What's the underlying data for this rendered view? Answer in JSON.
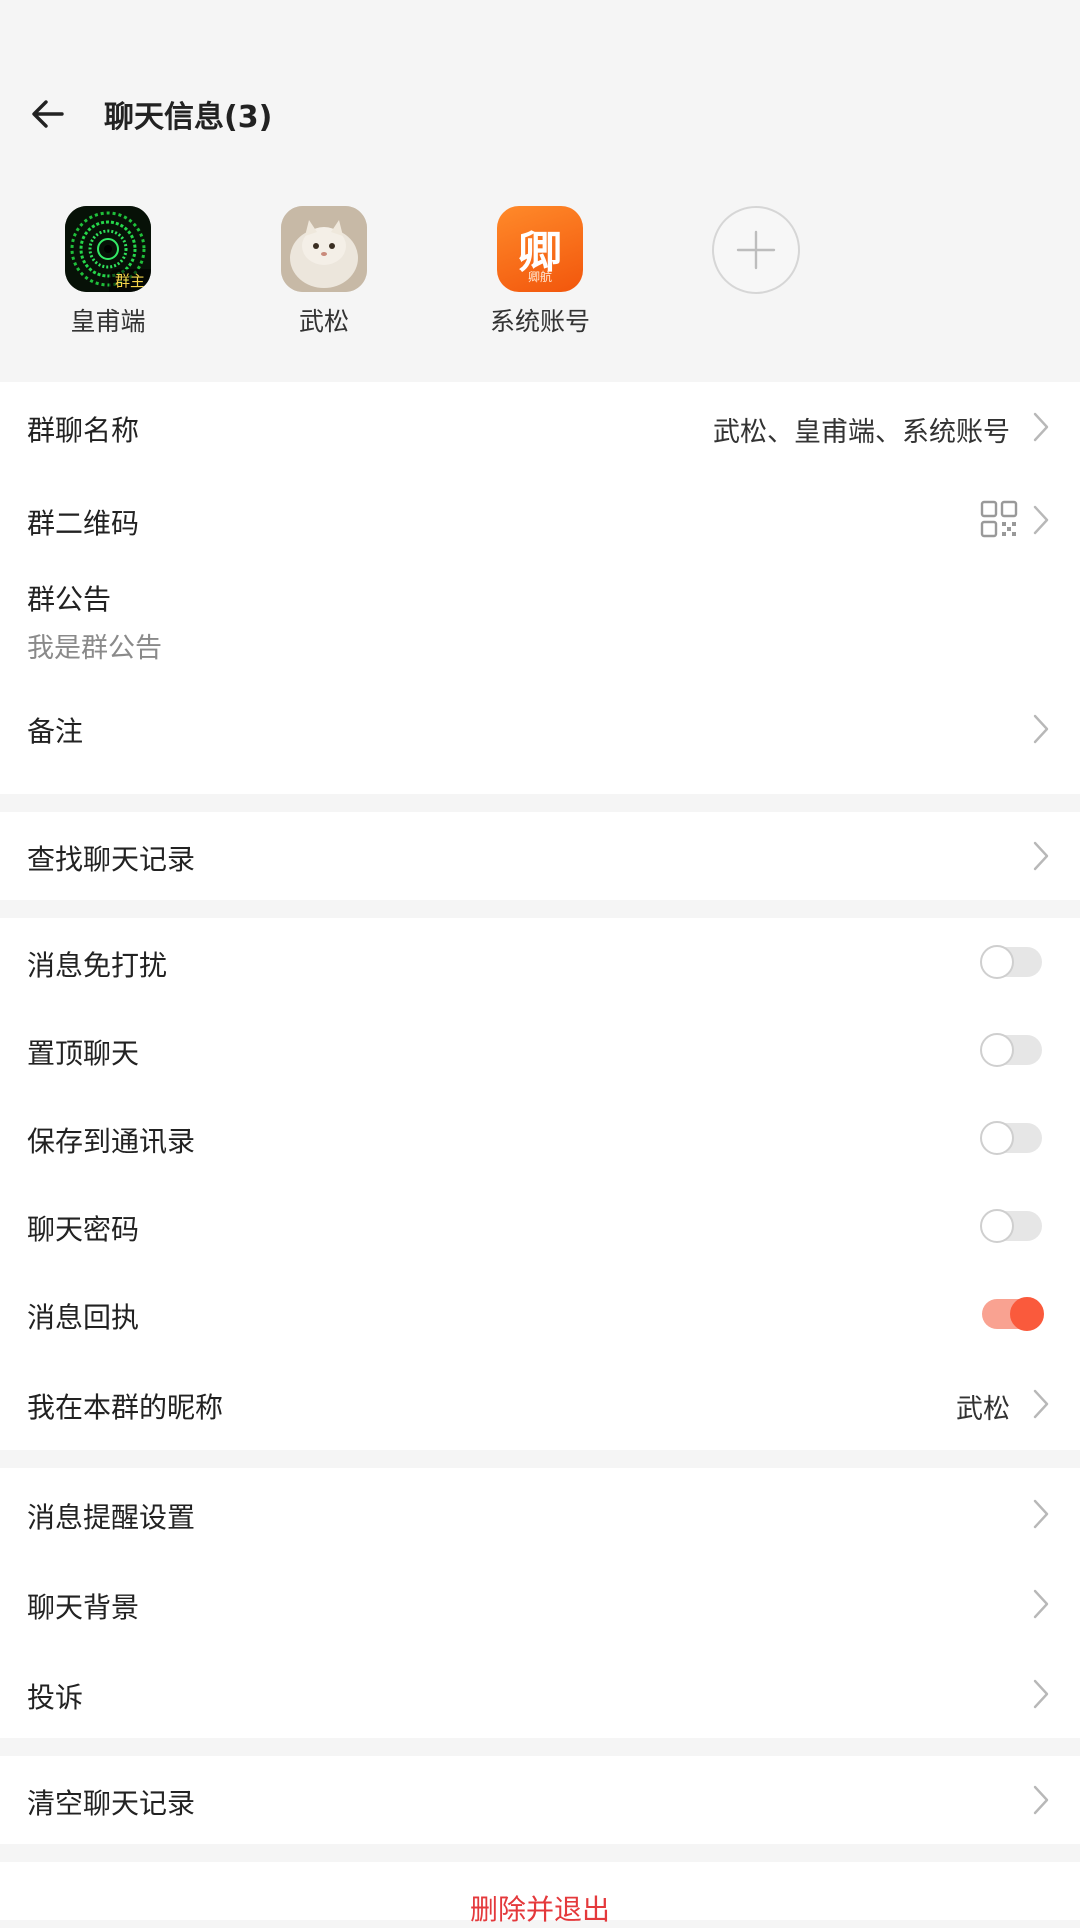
{
  "header": {
    "title": "聊天信息(3)"
  },
  "members": [
    {
      "name": "皇甫端",
      "badge": "群主",
      "avatar": "spiral-avatar"
    },
    {
      "name": "武松",
      "avatar": "cat-avatar"
    },
    {
      "name": "系统账号",
      "avatar": "app-logo-avatar",
      "logo_text": "卿",
      "logo_sub": "卿航"
    }
  ],
  "group": {
    "name_label": "群聊名称",
    "name_value": "武松、皇甫端、系统账号",
    "qrcode_label": "群二维码",
    "notice_label": "群公告",
    "notice_value": "我是群公告",
    "remark_label": "备注"
  },
  "search": {
    "label": "查找聊天记录"
  },
  "settings": {
    "mute_label": "消息免打扰",
    "mute_on": false,
    "pin_label": "置顶聊天",
    "pin_on": false,
    "save_contacts_label": "保存到通讯录",
    "save_contacts_on": false,
    "password_label": "聊天密码",
    "password_on": false,
    "receipt_label": "消息回执",
    "receipt_on": true,
    "nickname_label": "我在本群的昵称",
    "nickname_value": "武松"
  },
  "more": {
    "notify_label": "消息提醒设置",
    "background_label": "聊天背景",
    "complaint_label": "投诉"
  },
  "clear": {
    "label": "清空聊天记录"
  },
  "exit": {
    "label": "删除并退出"
  },
  "colors": {
    "accent": "#fa5a3c",
    "danger": "#e4393c",
    "toggle_off": "#e6e6e6"
  }
}
